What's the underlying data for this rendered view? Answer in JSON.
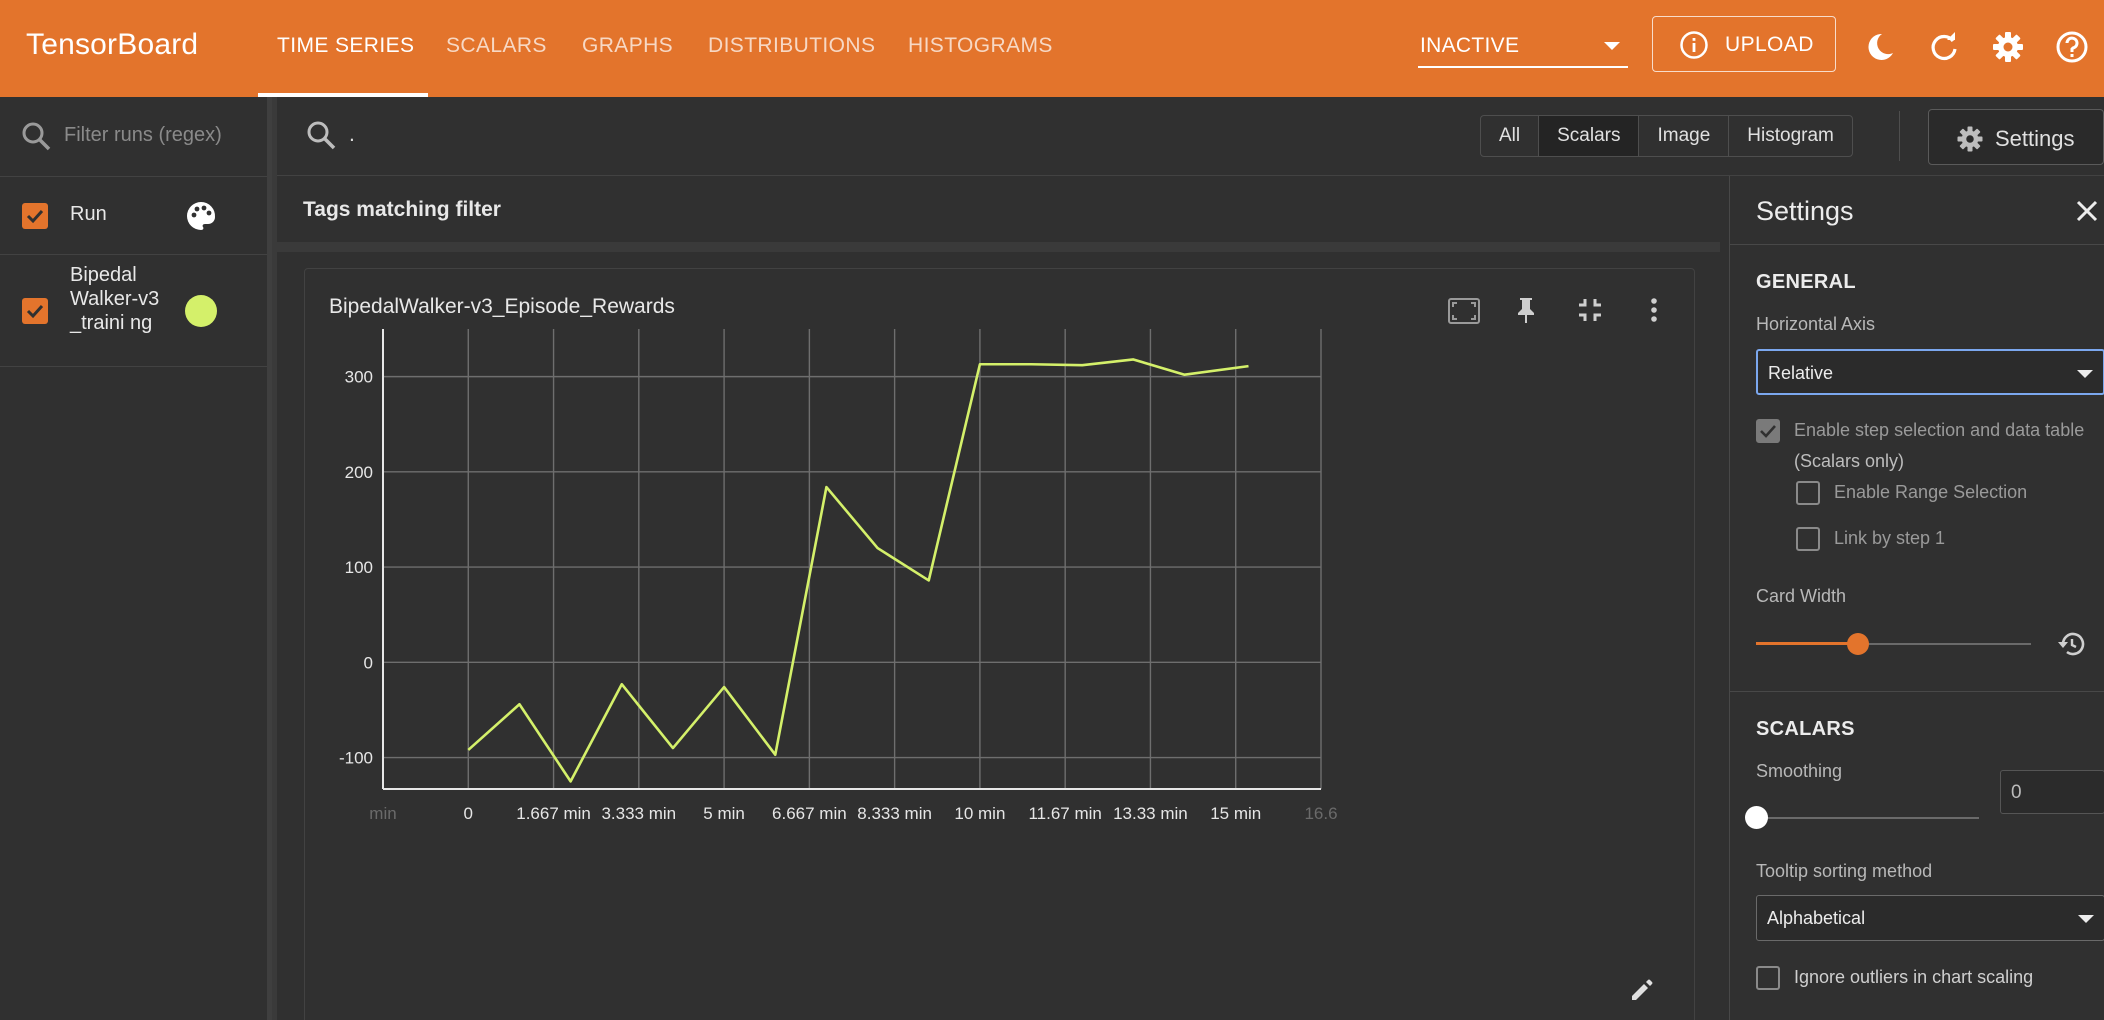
{
  "header": {
    "brand": "TensorBoard",
    "tabs": [
      {
        "label": "TIME SERIES",
        "active": true
      },
      {
        "label": "SCALARS",
        "active": false
      },
      {
        "label": "GRAPHS",
        "active": false
      },
      {
        "label": "DISTRIBUTIONS",
        "active": false
      },
      {
        "label": "HISTOGRAMS",
        "active": false
      }
    ],
    "inactive_select": "INACTIVE",
    "upload_label": "UPLOAD",
    "accent_color": "#e3742c"
  },
  "runs": {
    "filter_placeholder": "Filter runs (regex)",
    "header_label": "Run",
    "items": [
      {
        "name": "Bipedal Walker-v3_training",
        "display": "Bipedal Walker-v3_traini ng",
        "color": "#d4f06a",
        "checked": true
      }
    ]
  },
  "toolbar": {
    "tag_filter_value": ".",
    "type_filters": [
      {
        "label": "All",
        "active": false
      },
      {
        "label": "Scalars",
        "active": true
      },
      {
        "label": "Image",
        "active": false
      },
      {
        "label": "Histogram",
        "active": false
      }
    ],
    "settings_label": "Settings"
  },
  "tags": {
    "title": "Tags matching filter"
  },
  "card": {
    "title": "BipedalWalker-v3_Episode_Rewards"
  },
  "chart_data": {
    "type": "line",
    "title": "BipedalWalker-v3_Episode_Rewards",
    "xlabel": "",
    "ylabel": "",
    "x_tick_labels": [
      "min",
      "0",
      "1.667 min",
      "3.333 min",
      "5 min",
      "6.667 min",
      "8.333 min",
      "10 min",
      "11.67 min",
      "13.33 min",
      "15 min",
      "16.6"
    ],
    "x_tick_values": [
      -1.667,
      0,
      1.667,
      3.333,
      5,
      6.667,
      8.333,
      10,
      11.667,
      13.333,
      15,
      16.667
    ],
    "y_tick_labels": [
      "-100",
      "0",
      "100",
      "200",
      "300"
    ],
    "y_tick_values": [
      -100,
      0,
      100,
      200,
      300
    ],
    "xlim": [
      -1.667,
      16.667
    ],
    "ylim": [
      -133,
      350
    ],
    "grid": true,
    "series": [
      {
        "color": "#d4f06a",
        "x": [
          0,
          1.0,
          2.0,
          3.0,
          4.0,
          5.0,
          6.0,
          7.0,
          8.0,
          9.0,
          10.0,
          11.0,
          12.0,
          13.0,
          14.0,
          15.25
        ],
        "y": [
          -92,
          -44,
          -125,
          -23,
          -90,
          -26,
          -97,
          184,
          120,
          86,
          313,
          313,
          312,
          318,
          302,
          311
        ]
      }
    ]
  },
  "settings": {
    "title": "Settings",
    "general_heading": "GENERAL",
    "horizontal_axis_label": "Horizontal Axis",
    "horizontal_axis_value": "Relative",
    "step_selection_label": "Enable step selection and data table",
    "scalars_only_note": "(Scalars only)",
    "range_selection_label": "Enable Range Selection",
    "link_step_label": "Link by step 1",
    "card_width_label": "Card Width",
    "card_width_fraction": 0.37,
    "scalars_heading": "SCALARS",
    "smoothing_label": "Smoothing",
    "smoothing_value": "0",
    "tooltip_sort_label": "Tooltip sorting method",
    "tooltip_sort_value": "Alphabetical",
    "ignore_outliers_label": "Ignore outliers in chart scaling"
  }
}
